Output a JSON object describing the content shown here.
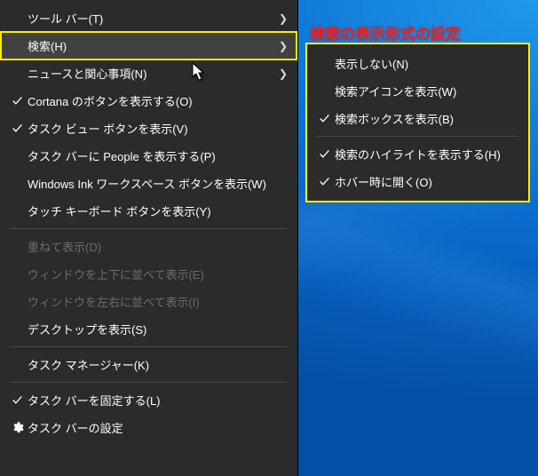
{
  "callout": "検索の表示形式の設定",
  "mainMenu": {
    "items": [
      {
        "label": "ツール バー(T)",
        "arrow": true
      },
      {
        "label": "検索(H)",
        "arrow": true,
        "highlight": true
      },
      {
        "label": "ニュースと関心事項(N)",
        "arrow": true
      },
      {
        "label": "Cortana のボタンを表示する(O)",
        "checked": true
      },
      {
        "label": "タスク ビュー ボタンを表示(V)",
        "checked": true
      },
      {
        "label": "タスク バーに People を表示する(P)"
      },
      {
        "label": "Windows Ink ワークスペース ボタンを表示(W)"
      },
      {
        "label": "タッチ キーボード ボタンを表示(Y)"
      },
      {
        "sep": true
      },
      {
        "label": "重ねて表示(D)",
        "disabled": true
      },
      {
        "label": "ウィンドウを上下に並べて表示(E)",
        "disabled": true
      },
      {
        "label": "ウィンドウを左右に並べて表示(I)",
        "disabled": true
      },
      {
        "label": "デスクトップを表示(S)"
      },
      {
        "sep": true
      },
      {
        "label": "タスク マネージャー(K)"
      },
      {
        "sep": true
      },
      {
        "label": "タスク バーを固定する(L)",
        "checked": true
      },
      {
        "label": "タスク バーの設定",
        "gear": true
      }
    ]
  },
  "subMenu": {
    "items": [
      {
        "label": "表示しない(N)"
      },
      {
        "label": "検索アイコンを表示(W)"
      },
      {
        "label": "検索ボックスを表示(B)",
        "checked": true
      },
      {
        "sep": true
      },
      {
        "label": "検索のハイライトを表示する(H)",
        "checked": true
      },
      {
        "label": "ホバー時に開く(O)",
        "checked": true
      }
    ]
  }
}
